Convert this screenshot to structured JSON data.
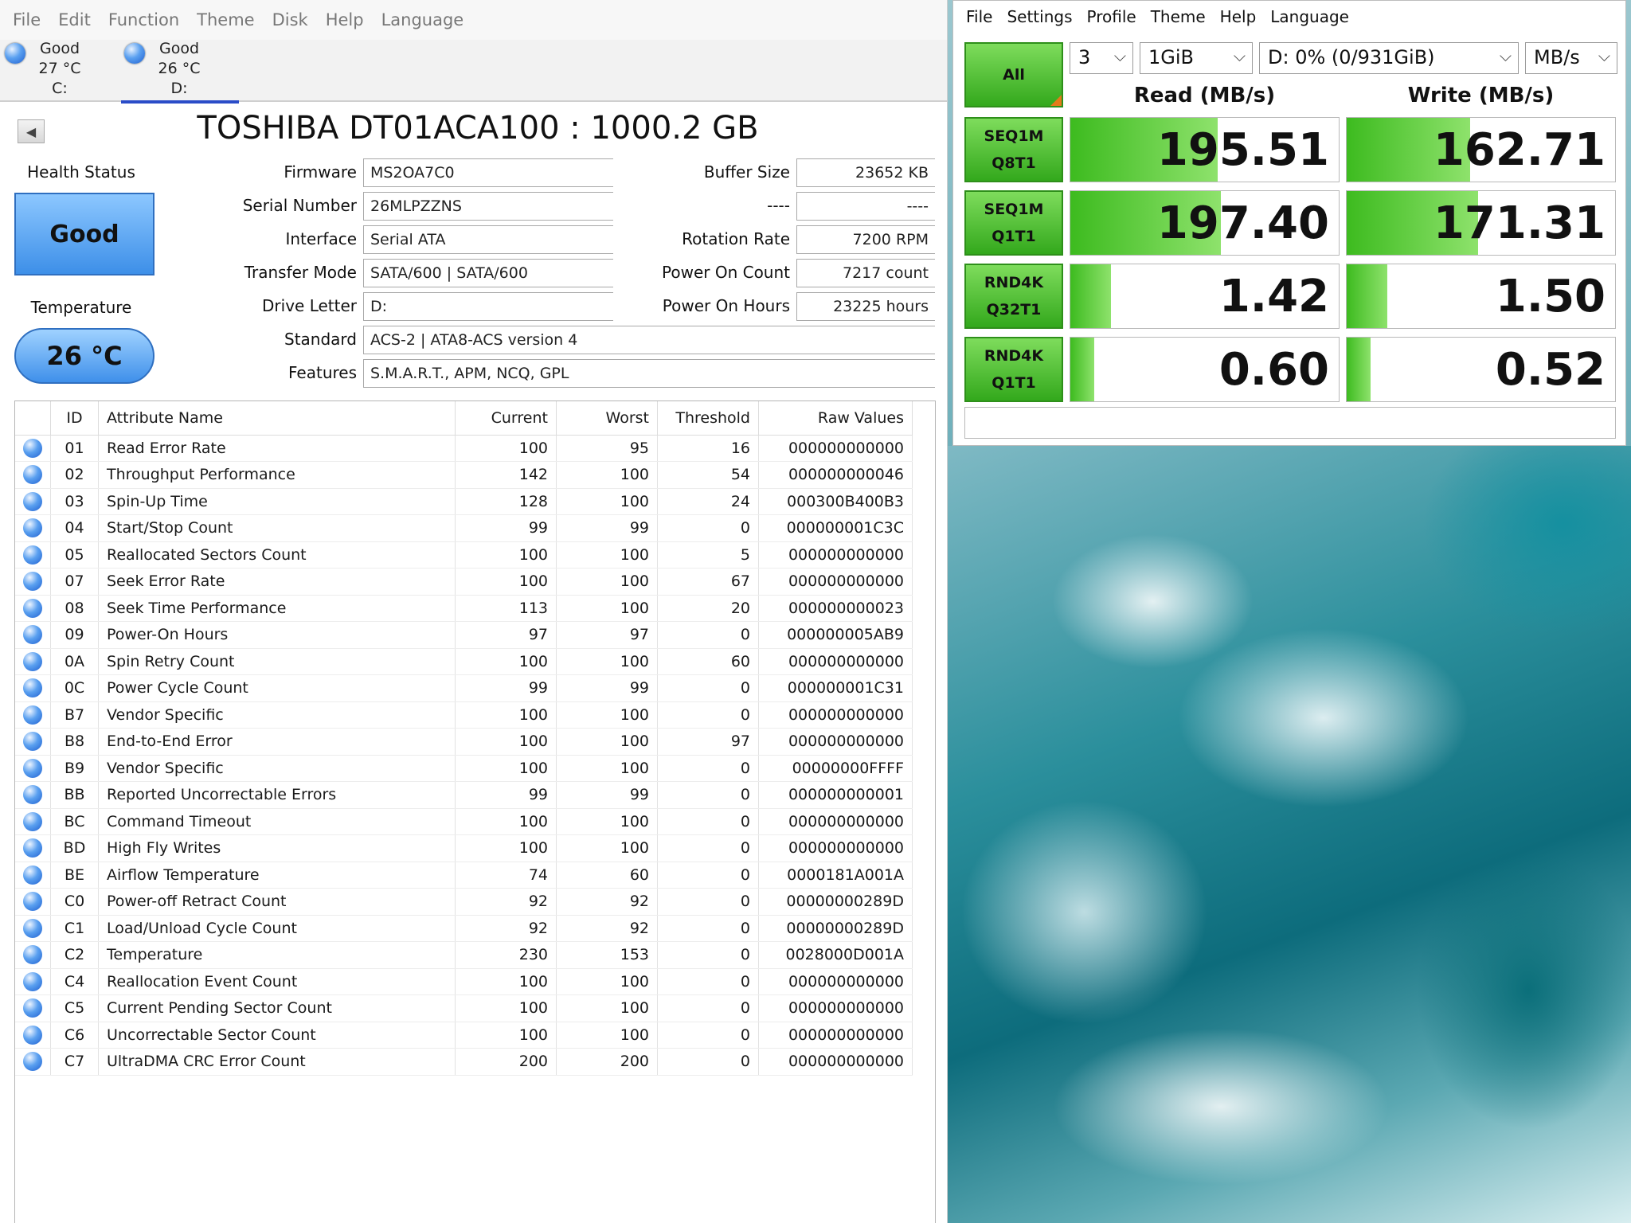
{
  "cdi": {
    "menu": [
      "File",
      "Edit",
      "Function",
      "Theme",
      "Disk",
      "Help",
      "Language"
    ],
    "drives": [
      {
        "status": "Good",
        "temp": "27 °C",
        "letter": "C:"
      },
      {
        "status": "Good",
        "temp": "26 °C",
        "letter": "D:"
      }
    ],
    "title": "TOSHIBA DT01ACA100 : 1000.2 GB",
    "health_label": "Health Status",
    "health_value": "Good",
    "temp_label": "Temperature",
    "temp_value": "26 °C",
    "info": {
      "firmware_label": "Firmware",
      "firmware": "MS2OA7C0",
      "serial_label": "Serial Number",
      "serial": "26MLPZZNS",
      "interface_label": "Interface",
      "interface": "Serial ATA",
      "transfer_label": "Transfer Mode",
      "transfer": "SATA/600 | SATA/600",
      "letter_label": "Drive Letter",
      "letter": "D:",
      "standard_label": "Standard",
      "standard": "ACS-2 | ATA8-ACS version 4",
      "features_label": "Features",
      "features": "S.M.A.R.T., APM, NCQ, GPL",
      "buffer_label": "Buffer Size",
      "buffer": "23652 KB",
      "blank_label": "----",
      "blank": "----",
      "rotation_label": "Rotation Rate",
      "rotation": "7200 RPM",
      "poweron_count_label": "Power On Count",
      "poweron_count": "7217 count",
      "poweron_hours_label": "Power On Hours",
      "poweron_hours": "23225 hours"
    },
    "table_headers": [
      "ID",
      "Attribute Name",
      "Current",
      "Worst",
      "Threshold",
      "Raw Values"
    ],
    "rows": [
      [
        "01",
        "Read Error Rate",
        "100",
        "95",
        "16",
        "000000000000"
      ],
      [
        "02",
        "Throughput Performance",
        "142",
        "100",
        "54",
        "000000000046"
      ],
      [
        "03",
        "Spin-Up Time",
        "128",
        "100",
        "24",
        "000300B400B3"
      ],
      [
        "04",
        "Start/Stop Count",
        "99",
        "99",
        "0",
        "000000001C3C"
      ],
      [
        "05",
        "Reallocated Sectors Count",
        "100",
        "100",
        "5",
        "000000000000"
      ],
      [
        "07",
        "Seek Error Rate",
        "100",
        "100",
        "67",
        "000000000000"
      ],
      [
        "08",
        "Seek Time Performance",
        "113",
        "100",
        "20",
        "000000000023"
      ],
      [
        "09",
        "Power-On Hours",
        "97",
        "97",
        "0",
        "000000005AB9"
      ],
      [
        "0A",
        "Spin Retry Count",
        "100",
        "100",
        "60",
        "000000000000"
      ],
      [
        "0C",
        "Power Cycle Count",
        "99",
        "99",
        "0",
        "000000001C31"
      ],
      [
        "B7",
        "Vendor Specific",
        "100",
        "100",
        "0",
        "000000000000"
      ],
      [
        "B8",
        "End-to-End Error",
        "100",
        "100",
        "97",
        "000000000000"
      ],
      [
        "B9",
        "Vendor Specific",
        "100",
        "100",
        "0",
        "00000000FFFF"
      ],
      [
        "BB",
        "Reported Uncorrectable Errors",
        "99",
        "99",
        "0",
        "000000000001"
      ],
      [
        "BC",
        "Command Timeout",
        "100",
        "100",
        "0",
        "000000000000"
      ],
      [
        "BD",
        "High Fly Writes",
        "100",
        "100",
        "0",
        "000000000000"
      ],
      [
        "BE",
        "Airflow Temperature",
        "74",
        "60",
        "0",
        "0000181A001A"
      ],
      [
        "C0",
        "Power-off Retract Count",
        "92",
        "92",
        "0",
        "00000000289D"
      ],
      [
        "C1",
        "Load/Unload Cycle Count",
        "92",
        "92",
        "0",
        "00000000289D"
      ],
      [
        "C2",
        "Temperature",
        "230",
        "153",
        "0",
        "0028000D001A"
      ],
      [
        "C4",
        "Reallocation Event Count",
        "100",
        "100",
        "0",
        "000000000000"
      ],
      [
        "C5",
        "Current Pending Sector Count",
        "100",
        "100",
        "0",
        "000000000000"
      ],
      [
        "C6",
        "Uncorrectable Sector Count",
        "100",
        "100",
        "0",
        "000000000000"
      ],
      [
        "C7",
        "UltraDMA CRC Error Count",
        "200",
        "200",
        "0",
        "000000000000"
      ]
    ]
  },
  "cdm": {
    "menu": [
      "File",
      "Settings",
      "Profile",
      "Theme",
      "Help",
      "Language"
    ],
    "all_label": "All",
    "count": "3",
    "size": "1GiB",
    "drive": "D: 0% (0/931GiB)",
    "unit": "MB/s",
    "read_header": "Read (MB/s)",
    "write_header": "Write (MB/s)",
    "tests": [
      {
        "line1": "SEQ1M",
        "line2": "Q8T1",
        "read": "195.51",
        "write": "162.71",
        "read_fill": 0.55,
        "write_fill": 0.46
      },
      {
        "line1": "SEQ1M",
        "line2": "Q1T1",
        "read": "197.40",
        "write": "171.31",
        "read_fill": 0.56,
        "write_fill": 0.49
      },
      {
        "line1": "RND4K",
        "line2": "Q32T1",
        "read": "1.42",
        "write": "1.50",
        "read_fill": 0.15,
        "write_fill": 0.15
      },
      {
        "line1": "RND4K",
        "line2": "Q1T1",
        "read": "0.60",
        "write": "0.52",
        "read_fill": 0.09,
        "write_fill": 0.09
      }
    ],
    "colors": {
      "green": "#3dbb1f",
      "accent_orange": "#e47a1a",
      "blue": "#2a4cc8"
    }
  }
}
